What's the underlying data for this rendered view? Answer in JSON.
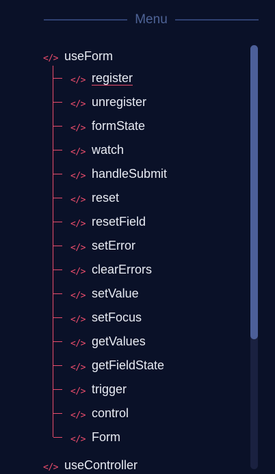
{
  "menu": {
    "title": "Menu"
  },
  "icons": {
    "code": "</>"
  },
  "colors": {
    "background": "#0a1128",
    "accent": "#ec4d6c",
    "header": "#4e6396",
    "scroll_thumb": "#4c5f99",
    "scroll_track": "#1a2140"
  },
  "groups": [
    {
      "label": "useForm",
      "items": [
        "register",
        "unregister",
        "formState",
        "watch",
        "handleSubmit",
        "reset",
        "resetField",
        "setError",
        "clearErrors",
        "setValue",
        "setFocus",
        "getValues",
        "getFieldState",
        "trigger",
        "control",
        "Form"
      ],
      "active_item": "register"
    },
    {
      "label": "useController"
    }
  ]
}
